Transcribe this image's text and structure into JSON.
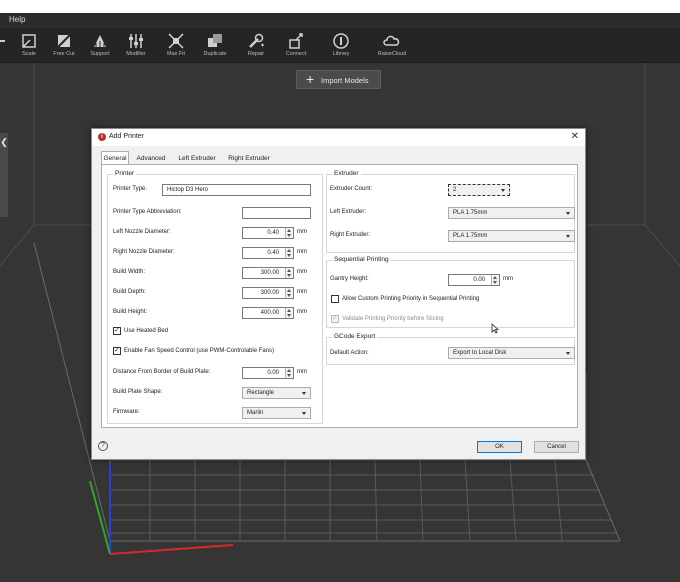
{
  "menubar": {
    "help": "Help"
  },
  "toolbar": {
    "tools": [
      {
        "key": "move",
        "label": "",
        "icon": "move-icon"
      },
      {
        "key": "scale",
        "label": "Scale",
        "icon": "scale-icon"
      },
      {
        "key": "free-cut",
        "label": "Free Cut",
        "icon": "free-cut-icon"
      },
      {
        "key": "support",
        "label": "Support",
        "icon": "support-icon"
      },
      {
        "key": "modifier",
        "label": "Modifier",
        "icon": "modifier-icon"
      },
      {
        "key": "max-fit",
        "label": "Max Fit",
        "icon": "max-fit-icon"
      },
      {
        "key": "duplicate",
        "label": "Duplicate",
        "icon": "duplicate-icon"
      },
      {
        "key": "repair",
        "label": "Repair",
        "icon": "repair-icon"
      },
      {
        "key": "connect",
        "label": "Connect",
        "icon": "connect-icon"
      },
      {
        "key": "library",
        "label": "Library",
        "icon": "library-icon"
      },
      {
        "key": "raisecloud",
        "label": "RaiseCloud",
        "icon": "cloud-icon"
      }
    ]
  },
  "import_button": {
    "label": "Import Models",
    "icon": "plus-icon"
  },
  "dialog": {
    "title": "Add Printer",
    "icon": "raise3d-logo-icon",
    "tabs": [
      "General",
      "Advanced",
      "Left Extruder",
      "Right Extruder"
    ],
    "active_tab": "General",
    "printer_group": {
      "title": "Printer",
      "printer_type_label": "Printer Type:",
      "printer_type_value": "Hictop D3 Hero",
      "abbreviation_label": "Printer Type Abbreviation:",
      "abbreviation_value": "",
      "left_nozzle_label": "Left Nozzle Diameter:",
      "left_nozzle_value": "0.40",
      "right_nozzle_label": "Right Nozzle Diameter:",
      "right_nozzle_value": "0.40",
      "build_width_label": "Build Width:",
      "build_width_value": "300.00",
      "build_depth_label": "Build Depth:",
      "build_depth_value": "300.00",
      "build_height_label": "Build Height:",
      "build_height_value": "400.00",
      "unit": "mm",
      "heated_bed_label": "Use Heated Bed",
      "heated_bed_checked": true,
      "fan_speed_label": "Enable Fan Speed Control (use PWM-Controlable Fans)",
      "fan_speed_checked": true,
      "distance_label": "Distance From Border of Build Plate:",
      "distance_value": "0.00",
      "plate_shape_label": "Build Plate Shape:",
      "plate_shape_value": "Rectangle",
      "firmware_label": "Firmware:",
      "firmware_value": "Marlin"
    },
    "extruder_group": {
      "title": "Extruder",
      "count_label": "Extruder Count:",
      "count_value": "2",
      "left_label": "Left Extruder:",
      "left_value": "PLA 1.75mm",
      "right_label": "Right Extruder:",
      "right_value": "PLA 1.75mm"
    },
    "sequential_group": {
      "title": "Sequential Printing",
      "gantry_label": "Gantry Height:",
      "gantry_value": "0.00",
      "unit": "mm",
      "custom_priority_label": "Allow Custom Printing Priority in Sequential Printing",
      "custom_priority_checked": false,
      "validate_label": "Validate Printing Priority before Slicing",
      "validate_checked": true
    },
    "gcode_group": {
      "title": "GCode Export",
      "action_label": "Default Action:",
      "action_value": "Export to Local Disk"
    },
    "ok_label": "OK",
    "cancel_label": "Cancel",
    "help_label": "?"
  },
  "colors": {
    "viewport_bg": "#353535",
    "grid_line": "#4a4a4a",
    "toolbar_bg": "#252525",
    "axis_x": "#d42a2a",
    "axis_y": "#2fa52f",
    "axis_z": "#2b3fd1"
  }
}
